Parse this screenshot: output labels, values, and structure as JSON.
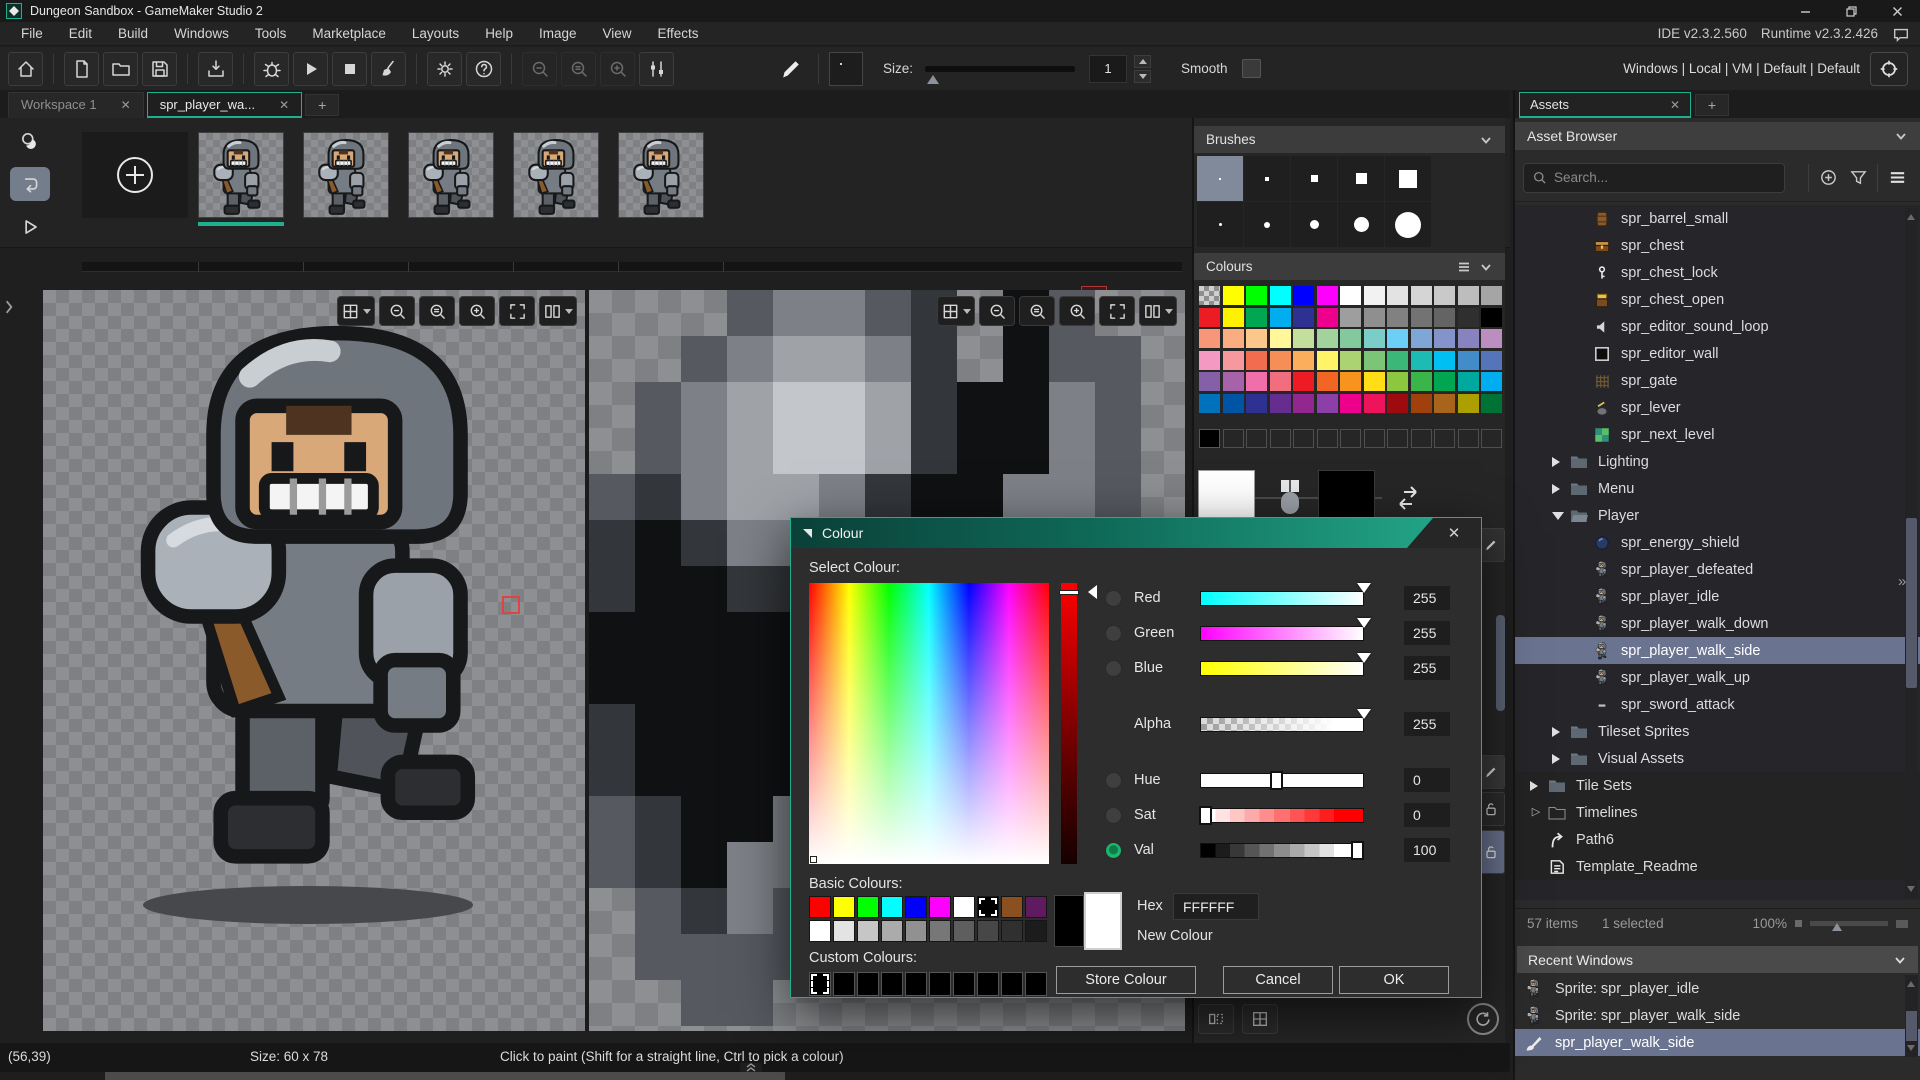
{
  "window": {
    "title": "Dungeon Sandbox - GameMaker Studio 2"
  },
  "menubar": {
    "items": [
      "File",
      "Edit",
      "Build",
      "Windows",
      "Tools",
      "Marketplace",
      "Layouts",
      "Help",
      "Image",
      "View",
      "Effects"
    ],
    "ide_version": "IDE v2.3.2.560",
    "runtime_version": "Runtime v2.3.2.426"
  },
  "toolbar": {
    "groups": [
      [
        "home"
      ],
      [
        "new-file",
        "open-folder",
        "save"
      ],
      [
        "import"
      ],
      [
        "debug",
        "run",
        "stop",
        "clean"
      ],
      [
        "settings",
        "help"
      ],
      [
        "zoom-out",
        "zoom-reset",
        "zoom-in",
        "window-scale"
      ]
    ],
    "disabled": [
      "zoom-out",
      "zoom-reset",
      "zoom-in"
    ],
    "size_label": "Size:",
    "size_value": "1",
    "smooth_label": "Smooth",
    "target_config": "Windows | Local | VM | Default | Default"
  },
  "workspace_tabs": [
    {
      "label": "Workspace 1",
      "active": false
    },
    {
      "label": "spr_player_wa...",
      "active": true
    }
  ],
  "frames": {
    "count": 5,
    "selected": 0,
    "mini_tools": [
      "onion-skin",
      "loop",
      "play-animation"
    ],
    "mini_selected": 1
  },
  "canvas": {
    "toolbar_icons": [
      "grid",
      "zoom-out",
      "zoom-reset",
      "zoom-in",
      "fit",
      "split"
    ],
    "pixel_palette": {
      "k": "#101113",
      "d": "#33363a",
      "m": "#565a60",
      "l": "#7d8187",
      "L": "#9fa3a8",
      "w": "#c3c6ca"
    },
    "zoom_pixels": [
      "...mllmd.km..",
      "..mlLLld.kmm.",
      ".mlLwwLdkklm.",
      ".mlLwwLdkklm.",
      "mdlLLldkkllm.",
      "dkdlldkkklmm.",
      "dkkddkkkklm..",
      "kkkkkkkkllm..",
      "kkkkkkkllmm..",
      "dkkkkkllmm...",
      "dkkkkllmm....",
      "mdkkllmm.....",
      "mdkllmm......",
      ".mdlmm.......",
      ".mmmm........",
      "..mm........."
    ]
  },
  "brushes_panel": {
    "title": "Brushes",
    "square_sizes": [
      2,
      4,
      7,
      11,
      18
    ],
    "circle_sizes": [
      3,
      6,
      9,
      15,
      26
    ]
  },
  "colours_panel": {
    "title": "Colours",
    "rows": [
      [
        "checker",
        "#FFFF00",
        "#00FF00",
        "#00FFFF",
        "#0000FF",
        "#FF00FF",
        "#FFFFFF",
        "#F2F2F2",
        "#E3E3E3",
        "#D5D5D5",
        "#C9C9C9",
        "#BDBDBD",
        "#A5A5A5"
      ],
      [
        "#ED1C24",
        "#FFF200",
        "#00A651",
        "#00AEEF",
        "#2E3192",
        "#EC008C",
        "#9E9E9E",
        "#8F8F8F",
        "#818181",
        "#737373",
        "#646464",
        "#2F2F2F",
        "#000000"
      ],
      [
        "#F7977A",
        "#F9AD81",
        "#FDC68A",
        "#FFF79A",
        "#C4DF9B",
        "#A2D39C",
        "#82CA9D",
        "#7BCDC8",
        "#6ECFF6",
        "#7EA7D8",
        "#8493CA",
        "#8882BE",
        "#BC8DBF"
      ],
      [
        "#F49AC2",
        "#F6989D",
        "#F26C4F",
        "#F68E55",
        "#FBAF5C",
        "#FFF467",
        "#ACD372",
        "#7CC576",
        "#3BB878",
        "#1CBBB4",
        "#00BFF3",
        "#438CCA",
        "#5574B9"
      ],
      [
        "#855FA8",
        "#A763A9",
        "#F06EA9",
        "#F26D7D",
        "#ED1C24",
        "#F26522",
        "#F7941D",
        "#FFDE17",
        "#8DC63F",
        "#39B54A",
        "#00A651",
        "#00A99D",
        "#00AEEF"
      ],
      [
        "#0072BC",
        "#0054A6",
        "#2E3192",
        "#662D91",
        "#92278F",
        "#8C3FA8",
        "#EC008C",
        "#ED145B",
        "#9E0B0F",
        "#A0410D",
        "#A9641C",
        "#ABA000",
        "#007236"
      ]
    ],
    "custom_row": [
      "#000000",
      "",
      "",
      "",
      "",
      "",
      "",
      "",
      "",
      "",
      "",
      "",
      ""
    ]
  },
  "colour_dialog": {
    "title": "Colour",
    "select_label": "Select Colour:",
    "sliders": [
      {
        "label": "Red",
        "value": "255",
        "kind": "red",
        "radio": true,
        "selected": false,
        "handle": "tri",
        "pos": 100
      },
      {
        "label": "Green",
        "value": "255",
        "kind": "green",
        "radio": true,
        "selected": false,
        "handle": "tri",
        "pos": 100
      },
      {
        "label": "Blue",
        "value": "255",
        "kind": "blue",
        "radio": true,
        "selected": false,
        "handle": "tri",
        "pos": 100
      },
      {
        "label": "Alpha",
        "value": "255",
        "kind": "alpha",
        "radio": false,
        "selected": false,
        "handle": "tri",
        "pos": 100
      },
      {
        "label": "Hue",
        "value": "0",
        "kind": "hue",
        "radio": true,
        "selected": false,
        "handle": "sq",
        "pos": 47
      },
      {
        "label": "Sat",
        "value": "0",
        "kind": "sat",
        "radio": true,
        "selected": false,
        "handle": "sq",
        "pos": 3
      },
      {
        "label": "Val",
        "value": "100",
        "kind": "val",
        "radio": true,
        "selected": true,
        "handle": "sq",
        "pos": 97
      }
    ],
    "basic_label": "Basic Colours:",
    "basic_rows": [
      [
        "#FF0000",
        "#FFFF00",
        "#00FF00",
        "#00FFFF",
        "#0000FF",
        "#FF00FF",
        "#FFFFFF",
        "#000000",
        "#8A5020",
        "#601A60"
      ],
      [
        "#FFFFFF",
        "#E3E3E3",
        "#C6C6C6",
        "#ABABAB",
        "#919191",
        "#777777",
        "#5E5E5E",
        "#474747",
        "#303030",
        "#1C1C1C"
      ]
    ],
    "basic_selected_row": 0,
    "basic_selected_col": 7,
    "hex_label": "Hex",
    "hex_value": "FFFFFF",
    "new_colour_label": "New Colour",
    "custom_label": "Custom Colours:",
    "custom_row": [
      "#000000",
      "#000000",
      "#000000",
      "#000000",
      "#000000",
      "#000000",
      "#000000",
      "#000000",
      "#000000",
      "#000000"
    ],
    "custom_selected": 0,
    "buttons": {
      "store": "Store Colour",
      "cancel": "Cancel",
      "ok": "OK"
    }
  },
  "assets_panel": {
    "tab_label": "Assets",
    "browser_title": "Asset Browser",
    "search_placeholder": "Search...",
    "search_icons": [
      "add-circle",
      "filter",
      "menu"
    ],
    "tree": [
      {
        "label": "spr_barrel_small",
        "icon": "barrel",
        "depth": 2
      },
      {
        "label": "spr_chest",
        "icon": "chest",
        "depth": 2
      },
      {
        "label": "spr_chest_lock",
        "icon": "key",
        "depth": 2
      },
      {
        "label": "spr_chest_open",
        "icon": "chest-open",
        "depth": 2
      },
      {
        "label": "spr_editor_sound_loop",
        "icon": "speaker",
        "depth": 2
      },
      {
        "label": "spr_editor_wall",
        "icon": "wall",
        "depth": 2
      },
      {
        "label": "spr_gate",
        "icon": "gate",
        "depth": 2
      },
      {
        "label": "spr_lever",
        "icon": "lever",
        "depth": 2
      },
      {
        "label": "spr_next_level",
        "icon": "next-level",
        "depth": 2
      },
      {
        "label": "Lighting",
        "icon": "folder",
        "depth": 1,
        "arrow": "collapsed"
      },
      {
        "label": "Menu",
        "icon": "folder",
        "depth": 1,
        "arrow": "collapsed"
      },
      {
        "label": "Player",
        "icon": "folder-open",
        "depth": 1,
        "arrow": "expanded"
      },
      {
        "label": "spr_energy_shield",
        "icon": "orb",
        "depth": 2
      },
      {
        "label": "spr_player_defeated",
        "icon": "knight",
        "depth": 2
      },
      {
        "label": "spr_player_idle",
        "icon": "knight",
        "depth": 2
      },
      {
        "label": "spr_player_walk_down",
        "icon": "knight",
        "depth": 2
      },
      {
        "label": "spr_player_walk_side",
        "icon": "knight",
        "depth": 2,
        "selected": true
      },
      {
        "label": "spr_player_walk_up",
        "icon": "knight",
        "depth": 2
      },
      {
        "label": "spr_sword_attack",
        "icon": "dash",
        "depth": 2
      },
      {
        "label": "Tileset Sprites",
        "icon": "folder",
        "depth": 1,
        "arrow": "collapsed"
      },
      {
        "label": "Visual Assets",
        "icon": "folder",
        "depth": 1,
        "arrow": "collapsed"
      },
      {
        "label": "Tile Sets",
        "icon": "folder",
        "depth": 0,
        "arrow": "collapsed",
        "root": true
      },
      {
        "label": "Timelines",
        "icon": "folder-empty",
        "depth": 0,
        "arrow": "collapsed-empty",
        "root": true
      },
      {
        "label": "Path6",
        "icon": "path",
        "depth": 0,
        "root": true
      },
      {
        "label": "Template_Readme",
        "icon": "note",
        "depth": 0,
        "root": true
      }
    ],
    "footer": {
      "items_count": "57 items",
      "selected_count": "1 selected",
      "zoom": "100%"
    },
    "recent": {
      "title": "Recent Windows",
      "items": [
        {
          "label": "Sprite: spr_player_idle",
          "icon": "knight",
          "selected": false
        },
        {
          "label": "Sprite: spr_player_walk_side",
          "icon": "knight",
          "selected": false
        },
        {
          "label": "spr_player_walk_side",
          "icon": "brush",
          "selected": true
        }
      ]
    }
  },
  "status_bar": {
    "cursor": "(56,39)",
    "size": "Size: 60 x 78",
    "hint": "Click to paint (Shift for a straight line, Ctrl to pick a colour)"
  }
}
